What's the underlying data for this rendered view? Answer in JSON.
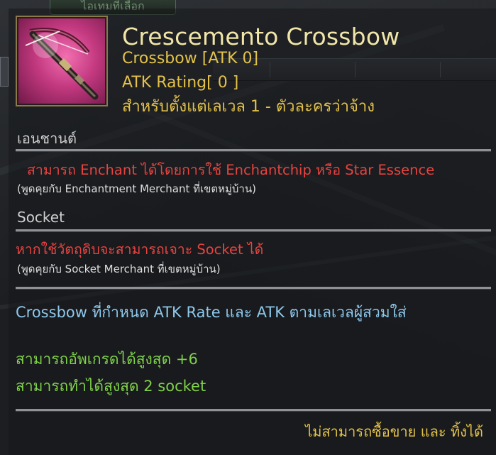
{
  "background": {
    "tab_label": "ไอเทมที่เลือก"
  },
  "item": {
    "icon": "crossbow-icon",
    "name": "Crescemento Crossbow",
    "type_line": "Crossbow [ATK 0]",
    "rating_line": "ATK Rating[ 0 ]",
    "level_line": "สำหรับตั้งแต่เลเวล 1 - ตัวละครว่าจ้าง"
  },
  "enchant": {
    "header": "เอนชานต์",
    "desc": "สามารถ Enchant ได้โดยการใช้ Enchantchip หรือ Star Essence",
    "note": "(พูดคุยกับ Enchantment Merchant ที่เขตหมู่บ้าน)"
  },
  "socket": {
    "header": "Socket",
    "desc": "หากใช้วัตถุดิบจะสามารถเจาะ Socket ได้",
    "note": "(พูดคุยกับ Socket Merchant ที่เขตหมู่บ้าน)"
  },
  "info": {
    "description": "Crossbow ที่กำหนด ATK Rate และ ATK ตามเลเวลผู้สวมใส่",
    "upgrade": "สามารถอัพเกรดได้สูงสุด +6",
    "sockets": "สามารถทำได้สูงสุด 2 socket"
  },
  "footer": {
    "trade": "ไม่สามารถซื้อขาย และ ทิ้งได้"
  },
  "colors": {
    "title": "#f1e6a8",
    "gold": "#e3c24a",
    "red": "#e8433f",
    "blue": "#8ec8ec",
    "green": "#7fd14a",
    "icon_bg": "#d8448f"
  }
}
